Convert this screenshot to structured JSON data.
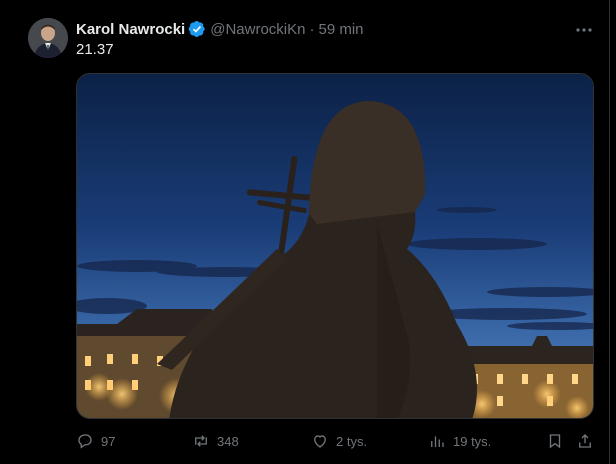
{
  "tweet": {
    "author_name": "Karol Nawrocki",
    "handle": "@NawrockiKn",
    "separator": "·",
    "time": "59 min",
    "text": "21.37"
  },
  "actions": {
    "replies": "97",
    "reposts": "348",
    "likes": "2 tys.",
    "views": "19 tys."
  },
  "icons": {
    "verified": "verified-badge-icon",
    "more": "more-icon",
    "reply": "reply-icon",
    "repost": "repost-icon",
    "like": "heart-icon",
    "views": "views-chart-icon",
    "bookmark": "bookmark-icon",
    "share": "share-icon"
  },
  "colors": {
    "background": "#000000",
    "text": "#e7e9ea",
    "secondary_text": "#71767b",
    "verified": "#1d9bf0",
    "border": "#2f3336"
  }
}
